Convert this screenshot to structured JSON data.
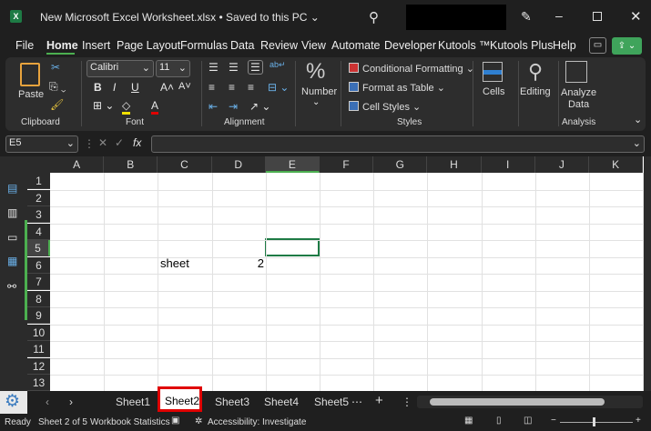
{
  "title_bar": {
    "title": "New Microsoft Excel Worksheet.xlsx • Saved to this PC ⌄",
    "app_icon": "X"
  },
  "menu": [
    "File",
    "Home",
    "Insert",
    "Page Layout",
    "Formulas",
    "Data",
    "Review",
    "View",
    "Automate",
    "Developer",
    "Kutools ™",
    "Kutools Plus",
    "Help"
  ],
  "menu_active": "Home",
  "ribbon": {
    "clipboard": {
      "paste": "Paste",
      "label": "Clipboard"
    },
    "font": {
      "name": "Calibri",
      "size": "11",
      "bold": "B",
      "italic": "I",
      "underline": "U",
      "grow": "A˄",
      "shrink": "A˅",
      "label": "Font"
    },
    "alignment": {
      "label": "Alignment"
    },
    "number": {
      "symbol": "%",
      "label": "Number"
    },
    "styles": {
      "conditional": "Conditional Formatting ⌄",
      "table": "Format as Table ⌄",
      "cell_styles": "Cell Styles ⌄",
      "label": "Styles"
    },
    "cells": {
      "label": "Cells"
    },
    "editing": {
      "label": "Editing"
    },
    "analysis": {
      "button": "Analyze Data",
      "button_l1": "Analyze",
      "button_l2": "Data",
      "label": "Analysis"
    }
  },
  "formula_bar": {
    "name_box": "E5",
    "fx": "fx",
    "value": ""
  },
  "columns": [
    "A",
    "B",
    "C",
    "D",
    "E",
    "F",
    "G",
    "H",
    "I",
    "J",
    "K"
  ],
  "rows": [
    "1",
    "2",
    "3",
    "4",
    "5",
    "6",
    "7",
    "8",
    "9",
    "10",
    "11",
    "12",
    "13"
  ],
  "cells": {
    "C6": "sheet",
    "D6": "2"
  },
  "selected_cell": "E5",
  "sheets": [
    "Sheet1",
    "Sheet2",
    "Sheet3",
    "Sheet4",
    "Sheet5"
  ],
  "active_sheet": "Sheet2",
  "status": {
    "ready": "Ready",
    "sheet_of": "Sheet 2 of 5",
    "stats": "Workbook Statistics",
    "accessibility": "Accessibility: Investigate"
  },
  "colors": {
    "accent": "#4caf50",
    "highlight_box": "#e00000",
    "excel_green": "#1e7b45"
  }
}
